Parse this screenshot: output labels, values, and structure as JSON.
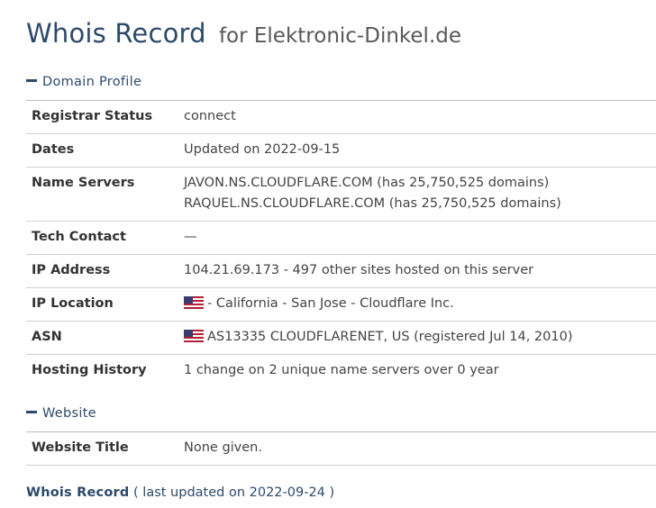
{
  "page": {
    "title_main": "Whois Record",
    "title_sub": "for Elektronic-Dinkel.de"
  },
  "domain_profile": {
    "header": "Domain Profile",
    "rows": [
      {
        "label": "Registrar Status",
        "values": [
          "connect"
        ]
      },
      {
        "label": "Dates",
        "values": [
          "Updated on 2022-09-15"
        ]
      },
      {
        "label": "Name Servers",
        "values": [
          "JAVON.NS.CLOUDFLARE.COM (has 25,750,525 domains)",
          "RAQUEL.NS.CLOUDFLARE.COM (has 25,750,525 domains)"
        ]
      },
      {
        "label": "Tech Contact",
        "values": [
          "—"
        ]
      },
      {
        "label": "IP Address",
        "values": [
          "104.21.69.173 - 497 other sites hosted on this server"
        ]
      },
      {
        "label": "IP Location",
        "values": [
          "- California - San Jose - Cloudflare Inc."
        ],
        "icon": "us-flag-icon"
      },
      {
        "label": "ASN",
        "values": [
          "AS13335 CLOUDFLARENET, US (registered Jul 14, 2010)"
        ],
        "icon": "us-flag-icon"
      },
      {
        "label": "Hosting History",
        "values": [
          "1 change on 2 unique name servers over 0 year"
        ]
      }
    ]
  },
  "website": {
    "header": "Website",
    "rows": [
      {
        "label": "Website Title",
        "values": [
          "None given."
        ]
      }
    ]
  },
  "footer": {
    "link": "Whois Record",
    "note": "( last updated on 2022-09-24 )"
  },
  "colors": {
    "accent": "#2c4a6b",
    "flag_red": "#b22234",
    "flag_blue": "#3c3b6e"
  }
}
